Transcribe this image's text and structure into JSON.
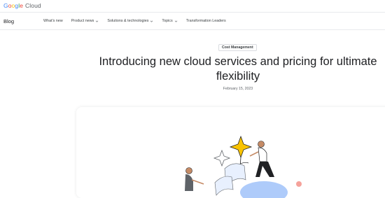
{
  "brand": {
    "logo_letters": [
      {
        "ch": "G",
        "color": "#4285F4"
      },
      {
        "ch": "o",
        "color": "#EA4335"
      },
      {
        "ch": "o",
        "color": "#FBBC05"
      },
      {
        "ch": "g",
        "color": "#4285F4"
      },
      {
        "ch": "l",
        "color": "#34A853"
      },
      {
        "ch": "e",
        "color": "#EA4335"
      }
    ],
    "product": "Cloud"
  },
  "nav": {
    "section": "Blog",
    "items": [
      {
        "label": "What's new",
        "has_dropdown": false
      },
      {
        "label": "Product news",
        "has_dropdown": true
      },
      {
        "label": "Solutions & technologies",
        "has_dropdown": true
      },
      {
        "label": "Topics",
        "has_dropdown": true
      },
      {
        "label": "Transformation Leaders",
        "has_dropdown": false
      }
    ]
  },
  "article": {
    "category": "Cost Management",
    "title": "Introducing new cloud services and pricing for ultimate flexibility",
    "date": "February 15, 2023"
  },
  "hero": {
    "colors": {
      "star": "#F9C300",
      "person_dark": "#202124",
      "paper": "#e8f0fe",
      "blob": "#aecbfa",
      "line": "#1a73e8"
    }
  }
}
